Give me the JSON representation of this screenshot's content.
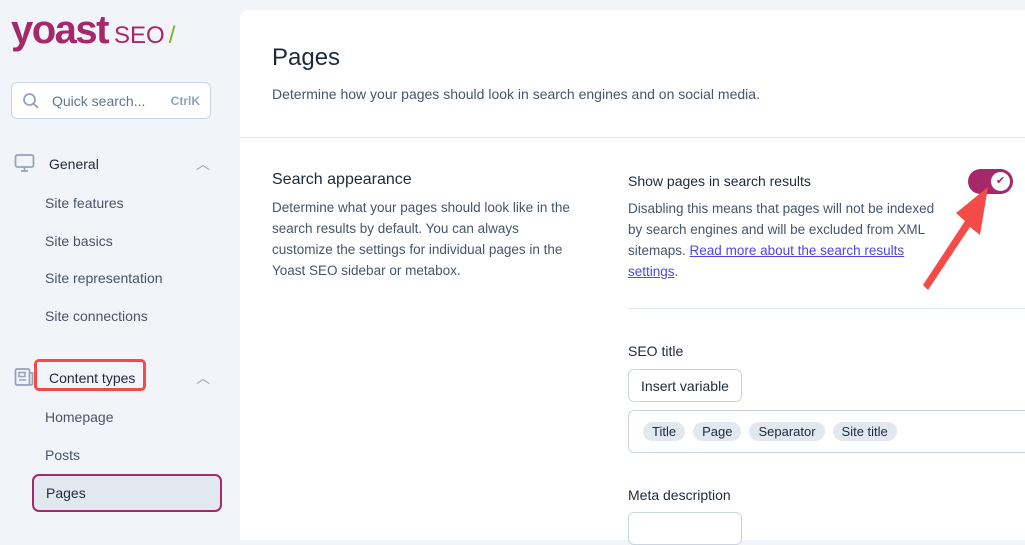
{
  "logo": {
    "brand": "yoast",
    "product": "SEO",
    "slash": "/"
  },
  "search": {
    "placeholder": "Quick search...",
    "shortcut": "CtrlK"
  },
  "sidebar": {
    "general": {
      "label": "General",
      "items": [
        "Site features",
        "Site basics",
        "Site representation",
        "Site connections"
      ]
    },
    "content_types": {
      "label": "Content types",
      "items": [
        "Homepage",
        "Posts",
        "Pages"
      ],
      "active": "Pages"
    }
  },
  "page": {
    "title": "Pages",
    "subtitle": "Determine how your pages should look in search engines and on social media."
  },
  "search_appearance": {
    "title": "Search appearance",
    "description": "Determine what your pages should look like in the search results by default. You can always customize the settings for individual pages in the Yoast SEO sidebar or metabox."
  },
  "toggle": {
    "label": "Show pages in search results",
    "description": "Disabling this means that pages will not be indexed by search engines and will be excluded from XML sitemaps.",
    "link": "Read more about the search results settings",
    "after": ".",
    "on": true
  },
  "seo_title": {
    "label": "SEO title",
    "insert_button": "Insert variable",
    "variables": [
      "Title",
      "Page",
      "Separator",
      "Site title"
    ]
  },
  "meta_description": {
    "label": "Meta description"
  },
  "colors": {
    "brand": "#a4286a",
    "highlight": "#f44a48"
  }
}
